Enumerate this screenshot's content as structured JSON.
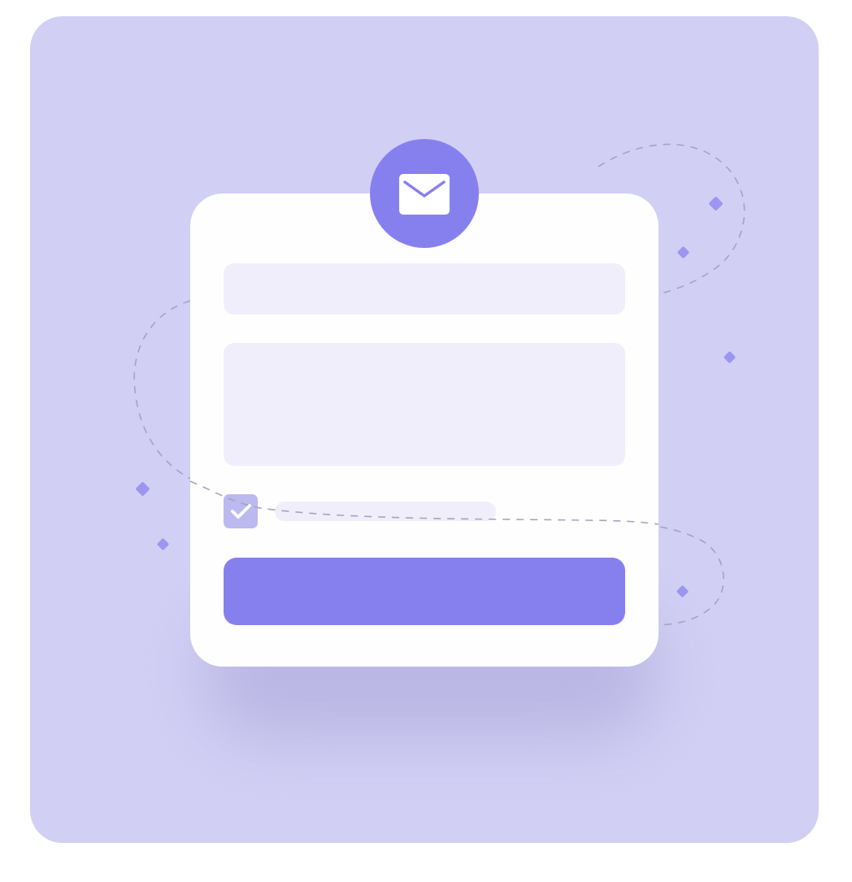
{
  "illustration": {
    "subject": "",
    "form": {
      "fields": [
        {
          "value": "",
          "placeholder": ""
        },
        {
          "value": "",
          "placeholder": ""
        }
      ],
      "checkbox": {
        "checked": true,
        "label": ""
      },
      "submit": {
        "label": ""
      }
    }
  },
  "colors": {
    "background_panel": "#d1cff4",
    "card": "#fefeff",
    "field": "#efeefa",
    "accent": "#8680ef",
    "checkbox": "#bcb8f0",
    "dashed_path": "#a6a3bd",
    "sparkle": "#9b96f0"
  },
  "icons": {
    "badge": "envelope-icon",
    "checkbox": "checkmark-icon",
    "sparkles": "diamond-sparkle-icon"
  }
}
